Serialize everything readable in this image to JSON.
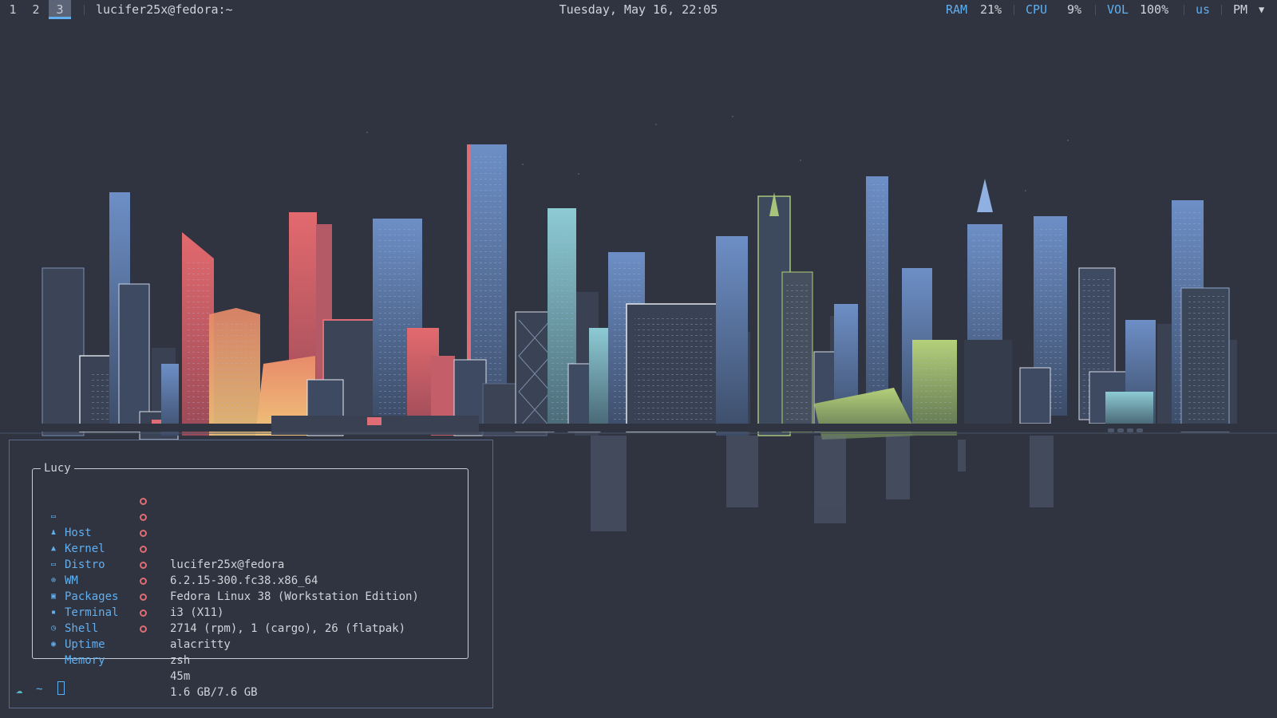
{
  "bar": {
    "workspaces": [
      "1",
      "2",
      "3"
    ],
    "active_workspace": "3",
    "window_title": "lucifer25x@fedora:~",
    "clock": "Tuesday, May 16, 22:05",
    "ram_label": "RAM",
    "ram_value": "21%",
    "cpu_label": "CPU",
    "cpu_value": "9%",
    "vol_label": "VOL",
    "vol_value": "100%",
    "keyboard_layout": "us",
    "ampm": "PM",
    "tray_icon": "triangle-down-icon"
  },
  "terminal": {
    "card_title": "Lucy",
    "rows": [
      {
        "icon": "monitor-icon",
        "key": "Host",
        "value": "lucifer25x@fedora"
      },
      {
        "icon": "penguin-icon",
        "key": "Kernel",
        "value": "6.2.15-300.fc38.x86_64"
      },
      {
        "icon": "arch-icon",
        "key": "Distro",
        "value": "Fedora Linux 38 (Workstation Edition)"
      },
      {
        "icon": "desktop-icon",
        "key": "WM",
        "value": "i3 (X11)"
      },
      {
        "icon": "package-icon",
        "key": "Packages",
        "value": "2714 (rpm), 1 (cargo), 26 (flatpak)"
      },
      {
        "icon": "terminal-icon",
        "key": "Terminal",
        "value": "alacritty"
      },
      {
        "icon": "shell-icon",
        "key": "Shell",
        "value": "zsh"
      },
      {
        "icon": "clock-icon",
        "key": "Uptime",
        "value": "45m"
      },
      {
        "icon": "memory-icon",
        "key": "Memory",
        "value": "1.6 GB/7.6 GB"
      }
    ],
    "prompt_dir": "~",
    "prompt_icon": "cloud-icon"
  },
  "colors": {
    "background": "#2f3440",
    "accent_blue": "#61afef",
    "accent_red": "#e06c75",
    "accent_cyan": "#56b6c2",
    "accent_green": "#a8c47a",
    "skyline_coral": "#e06c70"
  }
}
